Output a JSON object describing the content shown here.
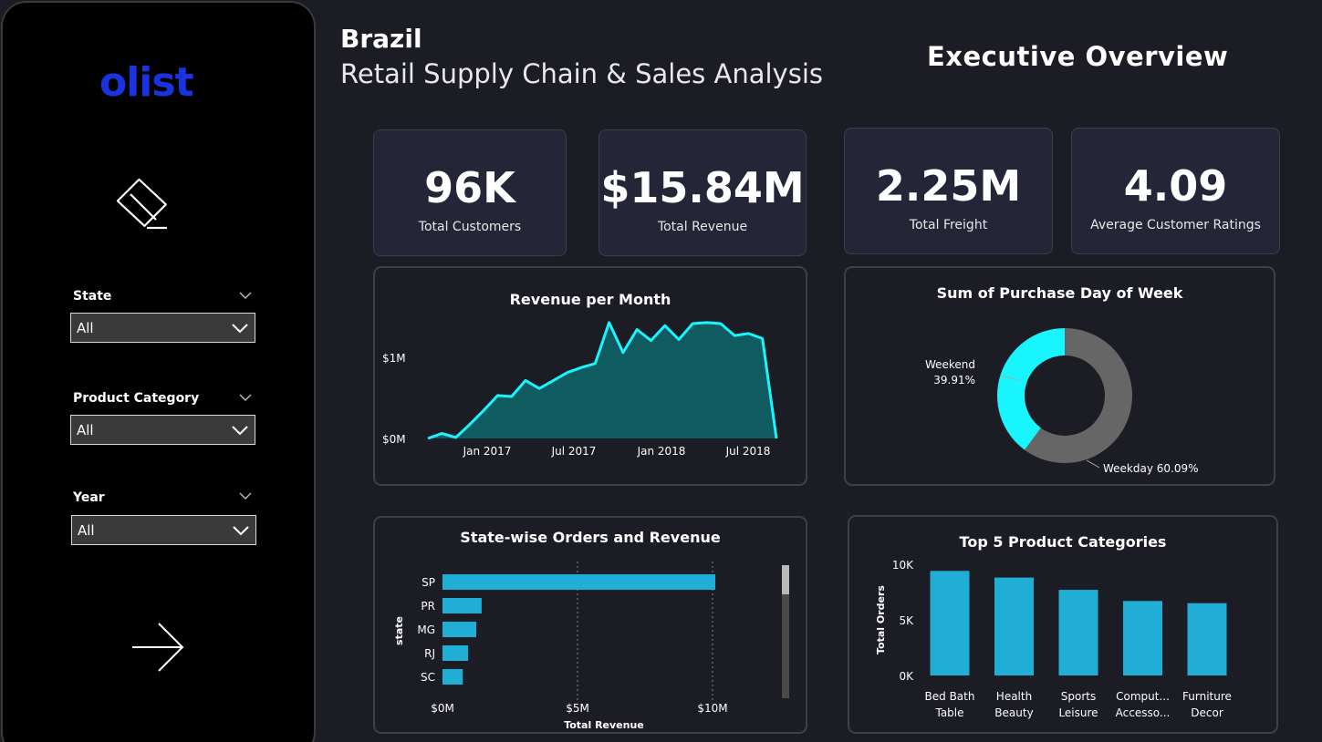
{
  "sidebar": {
    "logo": "olist",
    "filters": [
      {
        "label": "State",
        "value": "All"
      },
      {
        "label": "Product Category",
        "value": "All"
      },
      {
        "label": "Year",
        "value": "All"
      }
    ],
    "clear_icon": "eraser-icon",
    "next_icon": "arrow-right-icon"
  },
  "header": {
    "country": "Brazil",
    "subtitle": "Retail Supply Chain & Sales Analysis",
    "page_title": "Executive Overview"
  },
  "kpis": [
    {
      "value": "96K",
      "label": "Total Customers"
    },
    {
      "value": "$15.84M",
      "label": "Total Revenue"
    },
    {
      "value": "2.25M",
      "label": "Total Freight"
    },
    {
      "value": "4.09",
      "label": "Average Customer Ratings"
    }
  ],
  "colors": {
    "accent": "#19f5ff",
    "area_fill": "#0f5b60",
    "bar": "#20aed6",
    "donut_rest": "#666666",
    "logo": "#1a33e0"
  },
  "chart_data": [
    {
      "type": "area",
      "title": "Revenue per Month",
      "x": [
        "2016-09",
        "2016-10",
        "2016-12",
        "2017-01",
        "2017-02",
        "2017-03",
        "2017-04",
        "2017-05",
        "2017-06",
        "2017-07",
        "2017-08",
        "2017-09",
        "2017-10",
        "2017-11",
        "2017-12",
        "2018-01",
        "2018-02",
        "2018-03",
        "2018-04",
        "2018-05",
        "2018-06",
        "2018-07",
        "2018-08",
        "2018-09"
      ],
      "values": [
        0.0,
        0.05,
        0.01,
        0.14,
        0.28,
        0.43,
        0.42,
        0.58,
        0.5,
        0.58,
        0.66,
        0.71,
        0.75,
        1.16,
        0.86,
        1.09,
        0.98,
        1.13,
        0.99,
        1.15,
        1.16,
        1.15,
        1.03,
        1.05
      ],
      "values_tail": [
        1.0,
        0.0
      ],
      "x_tick_labels": [
        "Jan 2017",
        "Jul 2017",
        "Jan 2018",
        "Jul 2018"
      ],
      "y_tick_labels": [
        "$0M",
        "$1M"
      ],
      "ylim": [
        0,
        1.25
      ]
    },
    {
      "type": "pie",
      "title": "Sum of Purchase Day of Week",
      "slices": [
        {
          "label": "Weekend",
          "value": 39.91,
          "display": "39.91%"
        },
        {
          "label": "Weekday",
          "value": 60.09,
          "display": "Weekday 60.09%"
        }
      ]
    },
    {
      "type": "bar",
      "orientation": "horizontal",
      "title": "State-wise Orders and Revenue",
      "categories": [
        "SP",
        "PR",
        "MG",
        "RJ",
        "SC"
      ],
      "values": [
        10.1,
        1.45,
        1.25,
        0.95,
        0.75
      ],
      "xlabel": "Total Revenue",
      "ylabel": "state",
      "x_tick_labels": [
        "$0M",
        "$5M",
        "$10M"
      ],
      "xlim": [
        0,
        10.5
      ]
    },
    {
      "type": "bar",
      "title": "Top 5 Product Categories",
      "categories": [
        [
          "Bed Bath",
          "Table"
        ],
        [
          "Health",
          "Beauty"
        ],
        [
          "Sports",
          "Leisure"
        ],
        [
          "Comput...",
          "Accesso..."
        ],
        [
          "Furniture",
          "Decor"
        ]
      ],
      "values": [
        9400,
        8800,
        7700,
        6700,
        6500
      ],
      "ylabel": "Total Orders",
      "y_tick_labels": [
        "0K",
        "5K",
        "10K"
      ],
      "ylim": [
        0,
        10000
      ]
    }
  ]
}
